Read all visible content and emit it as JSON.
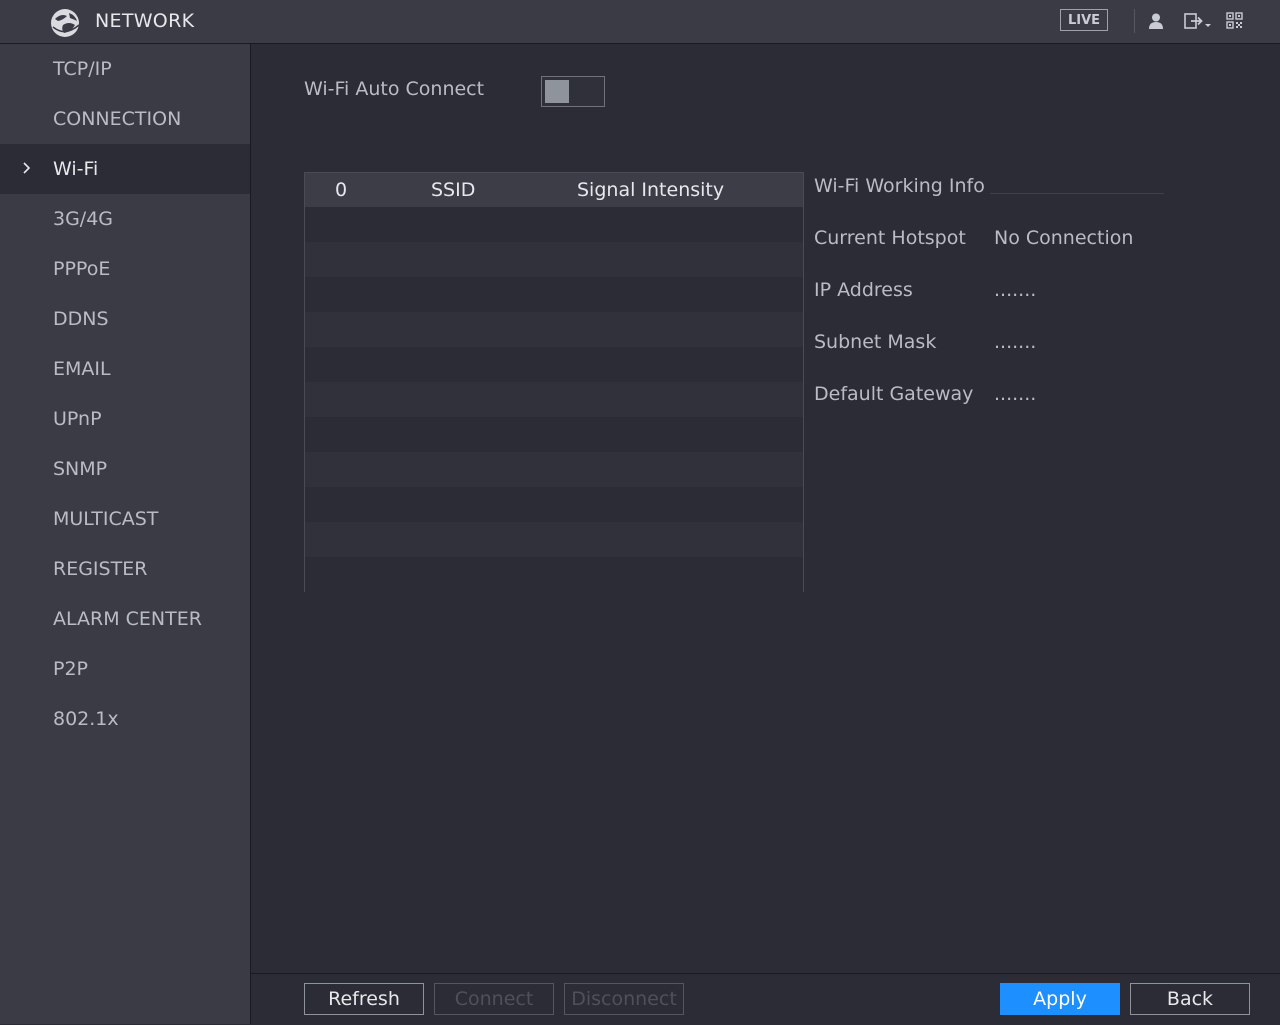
{
  "header": {
    "title": "NETWORK",
    "live_label": "LIVE",
    "icons": [
      "globe-logo-icon",
      "user-icon",
      "logout-icon",
      "qr-code-icon"
    ]
  },
  "sidebar": {
    "items": [
      {
        "label": "TCP/IP",
        "active": false
      },
      {
        "label": "CONNECTION",
        "active": false
      },
      {
        "label": "Wi-Fi",
        "active": true
      },
      {
        "label": "3G/4G",
        "active": false
      },
      {
        "label": "PPPoE",
        "active": false
      },
      {
        "label": "DDNS",
        "active": false
      },
      {
        "label": "EMAIL",
        "active": false
      },
      {
        "label": "UPnP",
        "active": false
      },
      {
        "label": "SNMP",
        "active": false
      },
      {
        "label": "MULTICAST",
        "active": false
      },
      {
        "label": "REGISTER",
        "active": false
      },
      {
        "label": "ALARM CENTER",
        "active": false
      },
      {
        "label": "P2P",
        "active": false
      },
      {
        "label": "802.1x",
        "active": false
      }
    ]
  },
  "wifi": {
    "auto_connect_label": "Wi-Fi Auto Connect",
    "auto_connect_on": false,
    "table": {
      "columns": [
        "0",
        "SSID",
        "Signal Intensity"
      ],
      "rows": []
    },
    "info": {
      "title": "Wi-Fi Working Info",
      "fields": [
        {
          "label": "Current Hotspot",
          "value": "No Connection"
        },
        {
          "label": "IP Address",
          "value": "......."
        },
        {
          "label": "Subnet Mask",
          "value": "......."
        },
        {
          "label": "Default Gateway",
          "value": "......."
        }
      ]
    }
  },
  "buttons": {
    "refresh": "Refresh",
    "connect": "Connect",
    "disconnect": "Disconnect",
    "apply": "Apply",
    "back": "Back"
  },
  "colors": {
    "accent": "#1e8fff",
    "background": "#2b2c35",
    "panel": "#3a3b45"
  }
}
